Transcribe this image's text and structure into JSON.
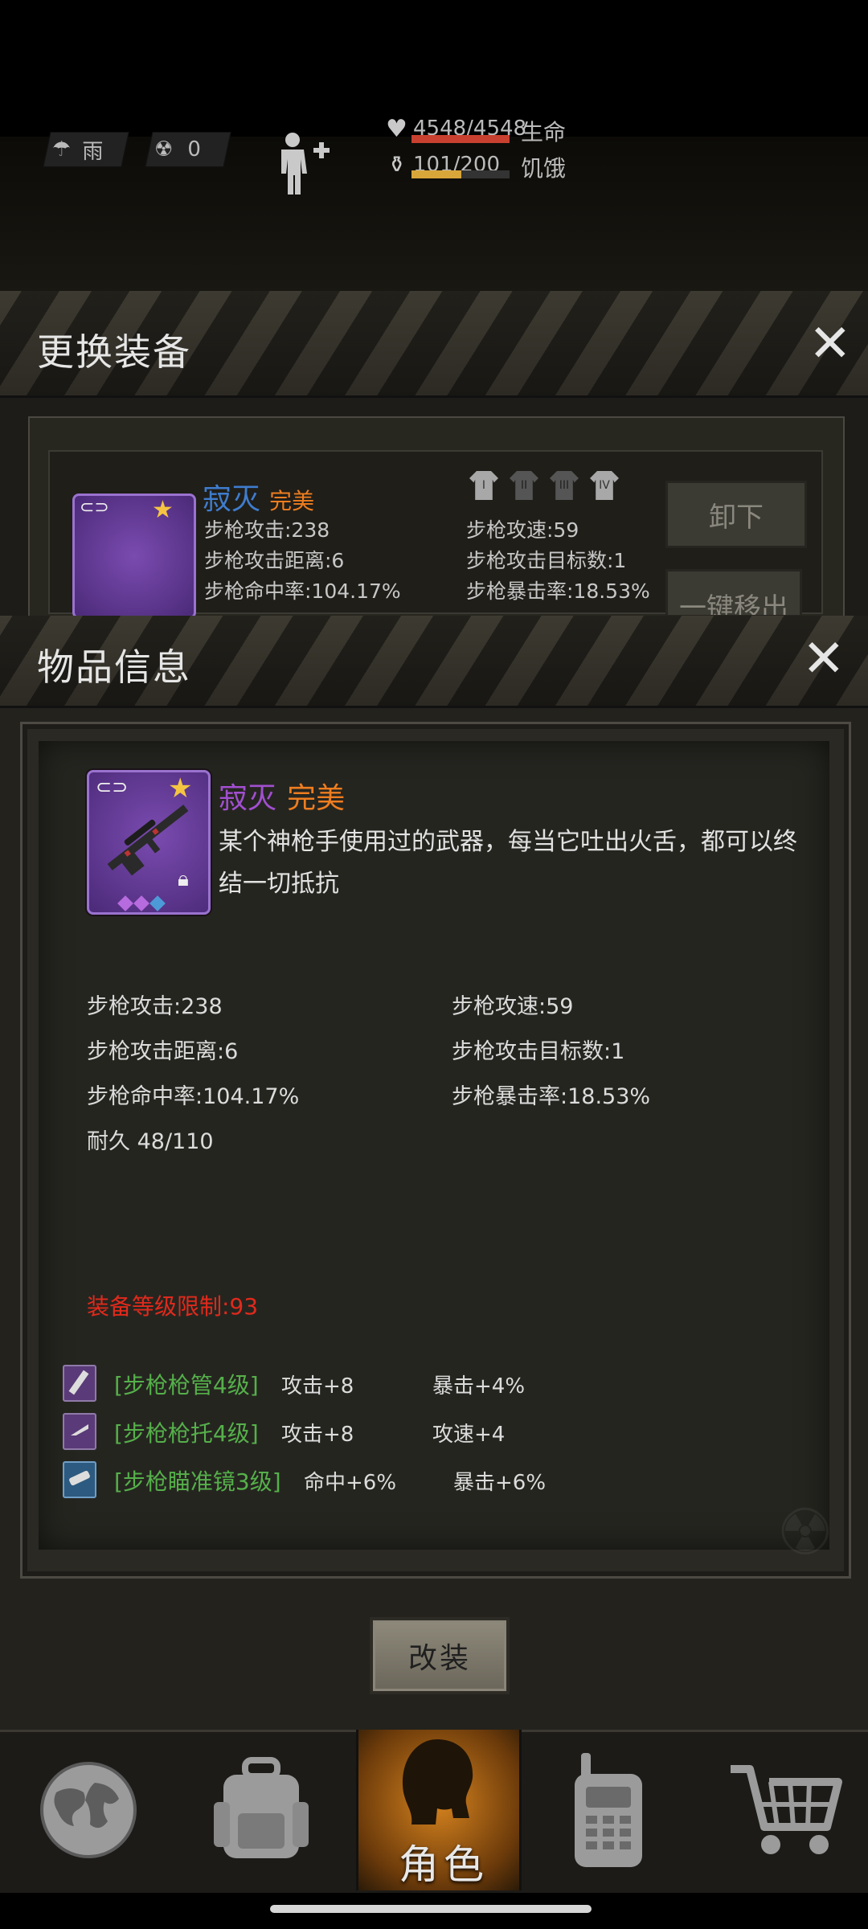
{
  "status": {
    "weather": "雨",
    "radiation": "0",
    "hp_value": "4548/4548",
    "hp_label": "生命",
    "hp_fraction": 1.0,
    "hunger_value": "101/200",
    "hunger_label": "饥饿",
    "hunger_fraction": 0.505
  },
  "equip_panel": {
    "title": "更换装备",
    "item_name": "寂灭",
    "item_quality": "完美",
    "stats_left": [
      "步枪攻击:238",
      "步枪攻击距离:6",
      "步枪命中率:104.17%"
    ],
    "stats_right": [
      "步枪攻速:59",
      "步枪攻击目标数:1",
      "步枪暴击率:18.53%"
    ],
    "slot_labels": [
      "I",
      "II",
      "III",
      "IV"
    ],
    "unequip_button": "卸下",
    "remove_button": "一键移出"
  },
  "info_panel": {
    "title": "物品信息",
    "item_name": "寂灭",
    "item_quality": "完美",
    "description": "某个神枪手使用过的武器，每当它吐出火舌，都可以终结一切抵抗",
    "stats_left": [
      "步枪攻击:238",
      "步枪攻击距离:6",
      "步枪命中率:104.17%",
      "耐久 48/110"
    ],
    "stats_right": [
      "步枪攻速:59",
      "步枪攻击目标数:1",
      "步枪暴击率:18.53%"
    ],
    "level_requirement": "装备等级限制:93",
    "mods": [
      {
        "name": "[步枪枪管4级]",
        "stat1": "攻击+8",
        "stat2": "暴击+4%",
        "icon": "barrel-icon"
      },
      {
        "name": "[步枪枪托4级]",
        "stat1": "攻击+8",
        "stat2": "攻速+4",
        "icon": "stock-icon"
      },
      {
        "name": "[步枪瞄准镜3级]",
        "stat1": "命中+6%",
        "stat2": "暴击+6%",
        "icon": "scope-icon"
      }
    ],
    "modify_button": "改装"
  },
  "nav": {
    "items": [
      "world-map",
      "backpack",
      "角色",
      "radio",
      "shop"
    ],
    "active_label": "角色"
  },
  "colors": {
    "accent_orange": "#ee7d1f",
    "item_purple": "#a24fd0",
    "requirement_red": "#e02a1c",
    "mod_green": "#55b04a",
    "hp_red": "#c8402f",
    "hunger_yellow": "#d9a63a"
  }
}
